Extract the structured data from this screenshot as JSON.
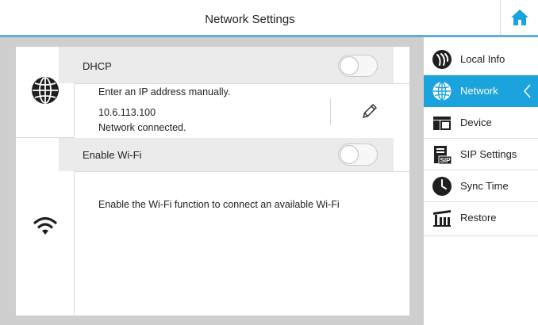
{
  "header": {
    "title": "Network Settings",
    "home_icon": "home-icon"
  },
  "network": {
    "dhcp_label": "DHCP",
    "dhcp_enabled": false,
    "manual_hint": "Enter an IP address manually.",
    "ip_address": "10.6.113.100",
    "status": "Network connected.",
    "edit_icon": "pencil-icon"
  },
  "wifi": {
    "enable_label": "Enable Wi-Fi",
    "wifi_enabled": false,
    "hint": "Enable the Wi-Fi function to connect an available Wi-Fi"
  },
  "sidebar": {
    "items": [
      {
        "label": "Local Info",
        "icon": "local-info-icon",
        "active": false
      },
      {
        "label": "Network",
        "icon": "globe-icon",
        "active": true
      },
      {
        "label": "Device",
        "icon": "device-icon",
        "active": false
      },
      {
        "label": "SIP Settings",
        "icon": "sip-icon",
        "active": false
      },
      {
        "label": "Sync Time",
        "icon": "clock-icon",
        "active": false
      },
      {
        "label": "Restore",
        "icon": "restore-icon",
        "active": false
      }
    ]
  },
  "colors": {
    "accent": "#1aa3dc",
    "header_line": "#5fb0d8",
    "panel_bg": "#cfcfcf",
    "row_gray": "#ebebeb"
  }
}
